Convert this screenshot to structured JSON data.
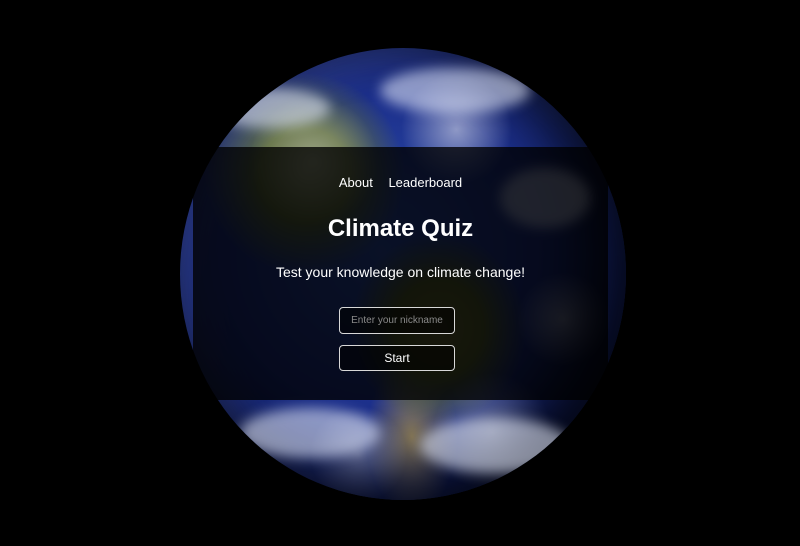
{
  "nav": {
    "about_label": "About",
    "leaderboard_label": "Leaderboard"
  },
  "hero": {
    "title": "Climate Quiz",
    "subtitle": "Test your knowledge on climate change!"
  },
  "form": {
    "nickname_placeholder": "Enter your nickname",
    "nickname_value": "",
    "start_label": "Start"
  },
  "background": {
    "icon": "earth-globe",
    "page_color": "#000000"
  }
}
